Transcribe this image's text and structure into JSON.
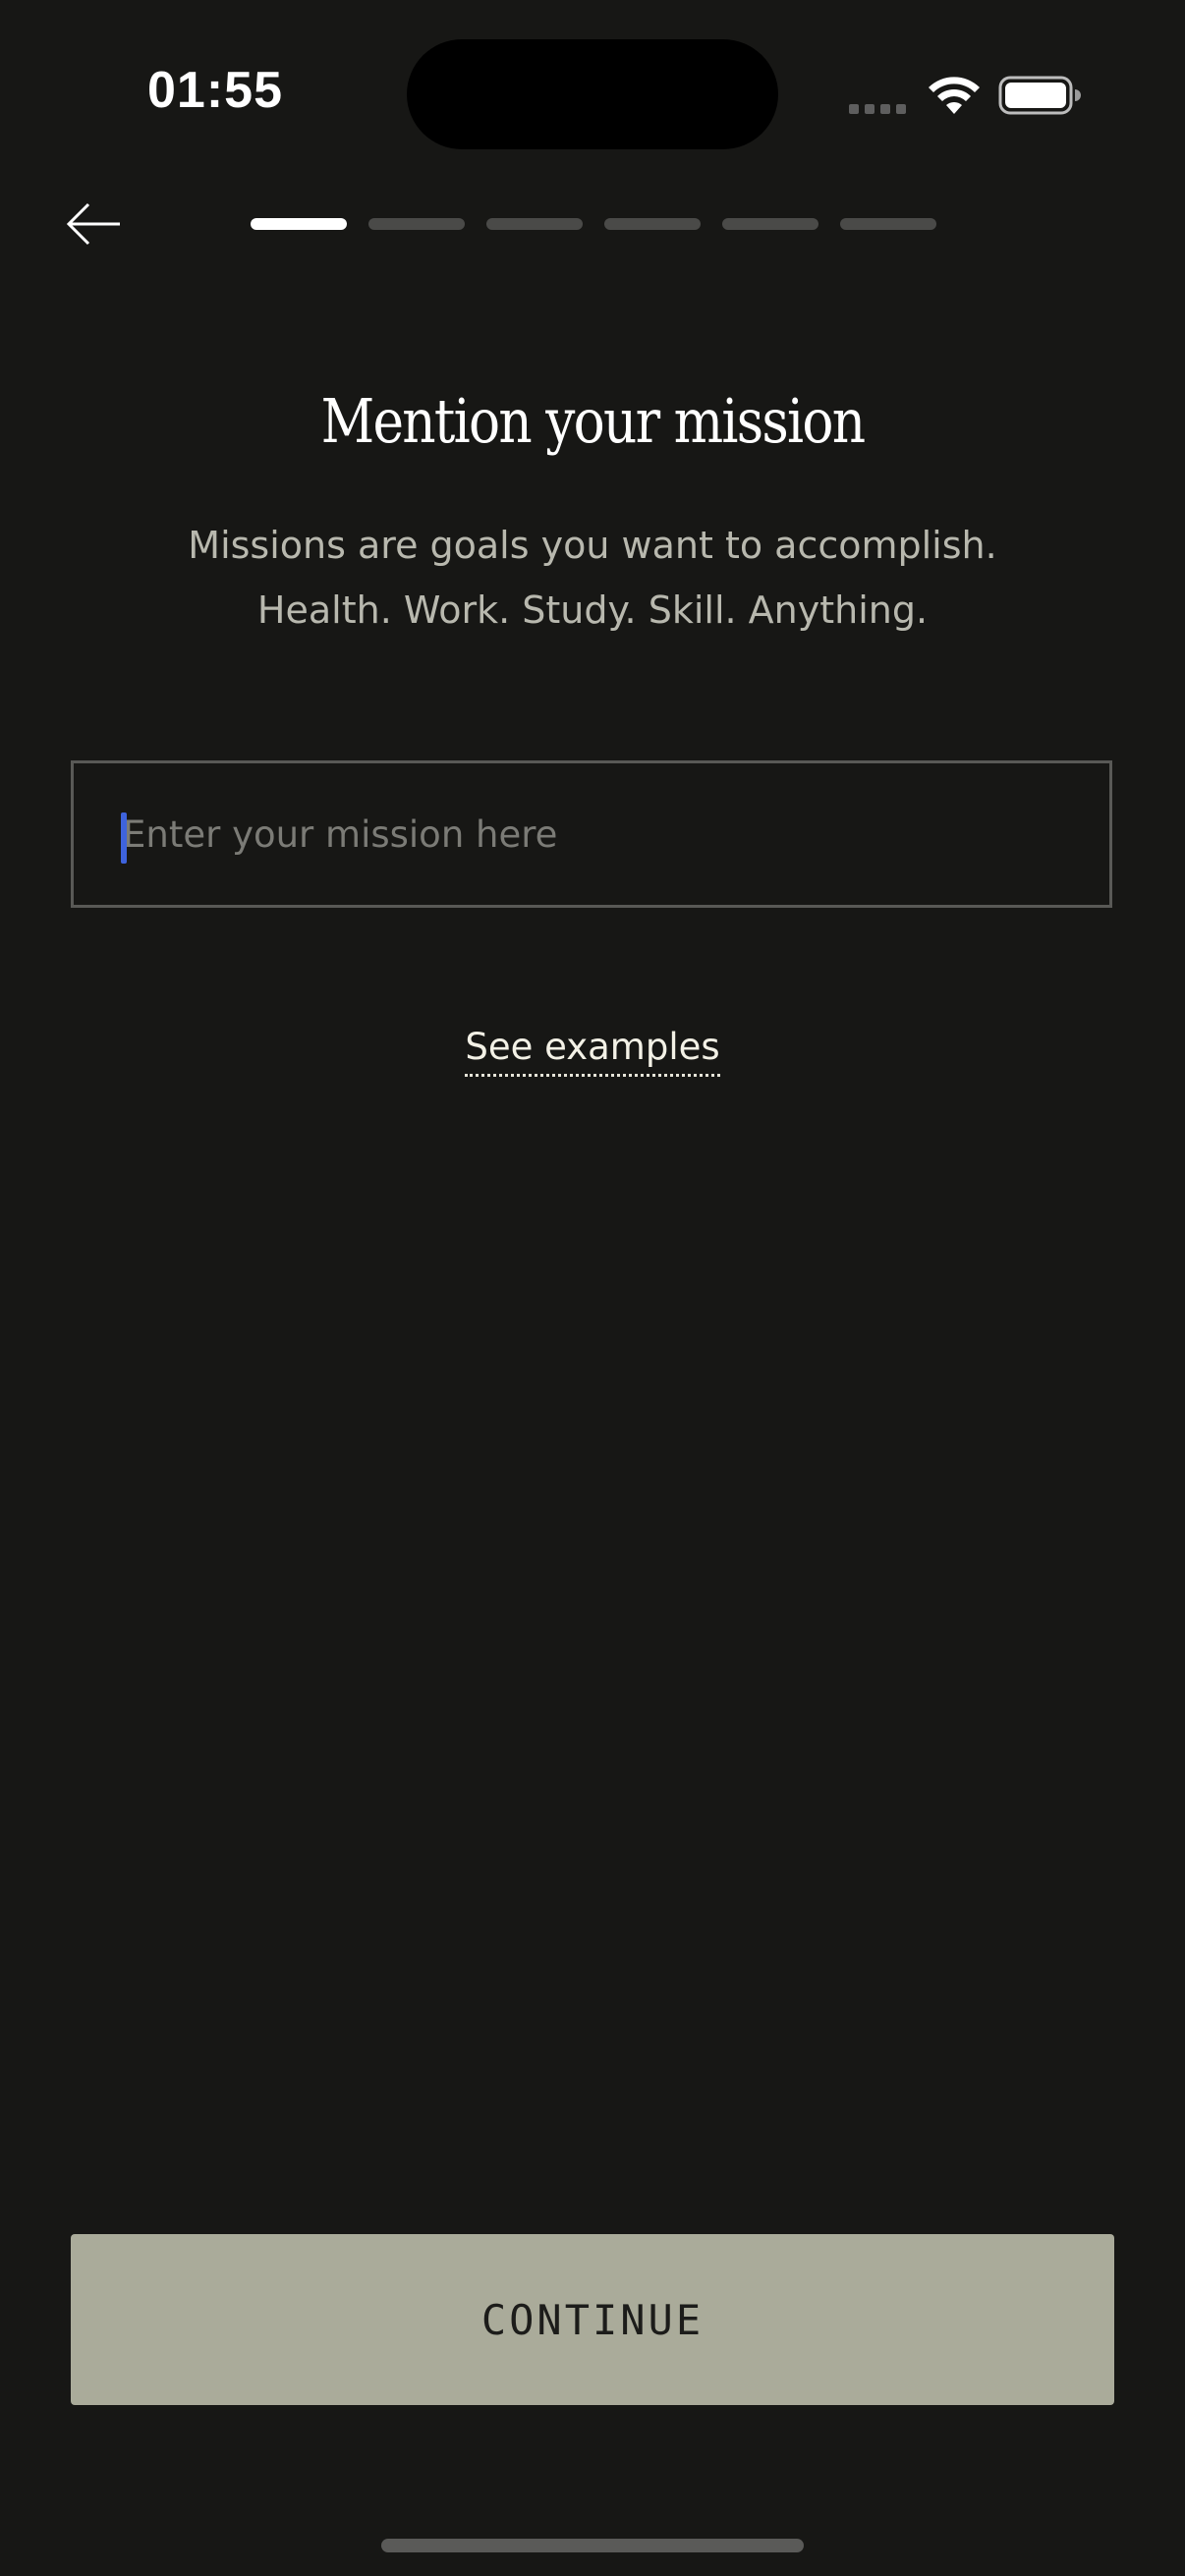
{
  "status_bar": {
    "time": "01:55",
    "icons": [
      "signal-dots-icon",
      "wifi-icon",
      "battery-icon"
    ]
  },
  "nav": {
    "back_icon": "arrow-left-icon",
    "progress": {
      "total_steps": 6,
      "current_step": 1
    }
  },
  "main": {
    "title": "Mention your mission",
    "subtitle_line1": "Missions are goals you want to accomplish.",
    "subtitle_line2": "Health. Work. Study. Skill. Anything.",
    "mission_input": {
      "value": "",
      "placeholder": "Enter your mission here"
    },
    "see_examples_label": "See examples"
  },
  "footer": {
    "continue_label": "CONTINUE"
  },
  "colors": {
    "background": "#171715",
    "button_bg": "#aaab9a",
    "progress_active": "#ffffff",
    "progress_inactive": "#4a4a48",
    "caret": "#3e63dd"
  }
}
